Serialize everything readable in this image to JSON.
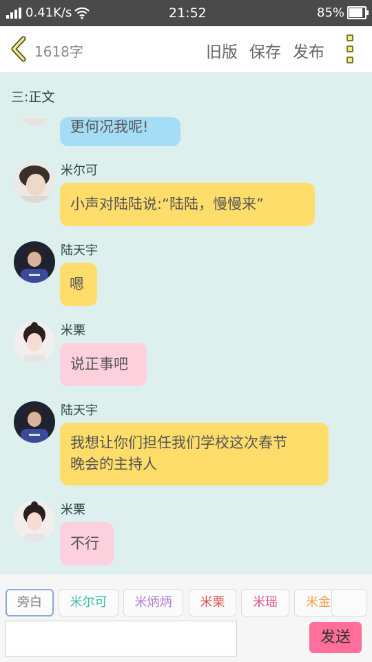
{
  "status_bar": {
    "network_speed": "0.41K/s",
    "time": "21:52",
    "battery_text": "85%",
    "battery_level": 0.85
  },
  "header": {
    "word_count": "1618字",
    "old_version": "旧版",
    "save": "保存",
    "publish": "发布"
  },
  "chat": {
    "section_title": "三:正文",
    "messages": [
      {
        "name": "",
        "text": "更何况我呢!"
      },
      {
        "name": "米尔可",
        "text": "小声对陆陆说:“陆陆，慢慢来”"
      },
      {
        "name": "陆天宇",
        "text": "嗯"
      },
      {
        "name": "米栗",
        "text": "说正事吧"
      },
      {
        "name": "陆天宇",
        "text_line1": "我想让你们担任我们学校这次春节",
        "text_line2": "晚会的主持人"
      },
      {
        "name": "米栗",
        "text": "不行"
      }
    ]
  },
  "roles": [
    {
      "label": "旁白",
      "color": "#888888"
    },
    {
      "label": "米尔可",
      "color": "#3cbfa8"
    },
    {
      "label": "米炳炳",
      "color": "#b67bd1"
    },
    {
      "label": "米栗",
      "color": "#d9534f"
    },
    {
      "label": "米瑶",
      "color": "#e0508a"
    },
    {
      "label": "米金",
      "color": "#f0a050"
    },
    {
      "label": "",
      "color": "#888888"
    }
  ],
  "composer": {
    "input_value": "",
    "send_label": "发送"
  }
}
